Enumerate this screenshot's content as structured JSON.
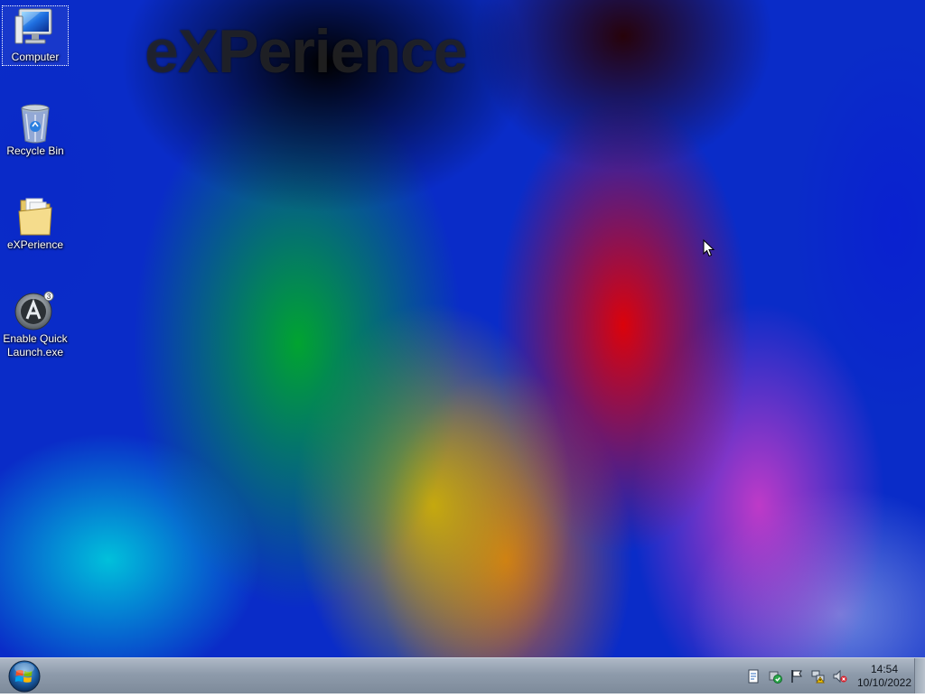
{
  "wallpaper": {
    "title": "eXPerience"
  },
  "desktop": {
    "icons": [
      {
        "label": "Computer",
        "icon": "computer-icon"
      },
      {
        "label": "Recycle Bin",
        "icon": "recycle-bin-icon"
      },
      {
        "label": "eXPerience",
        "icon": "folder-icon"
      },
      {
        "label": "Enable Quick Launch.exe",
        "icon": "app-icon"
      }
    ]
  },
  "taskbar": {
    "start_icon": "windows-orb-icon",
    "tray_icons": [
      "document-icon",
      "security-icon",
      "action-center-flag-icon",
      "network-icon",
      "volume-muted-icon"
    ],
    "clock": {
      "time": "14:54",
      "date": "10/10/2022"
    }
  },
  "colors": {
    "taskbar": "#8e9bab",
    "desktop_base": "#0a2cc8"
  }
}
